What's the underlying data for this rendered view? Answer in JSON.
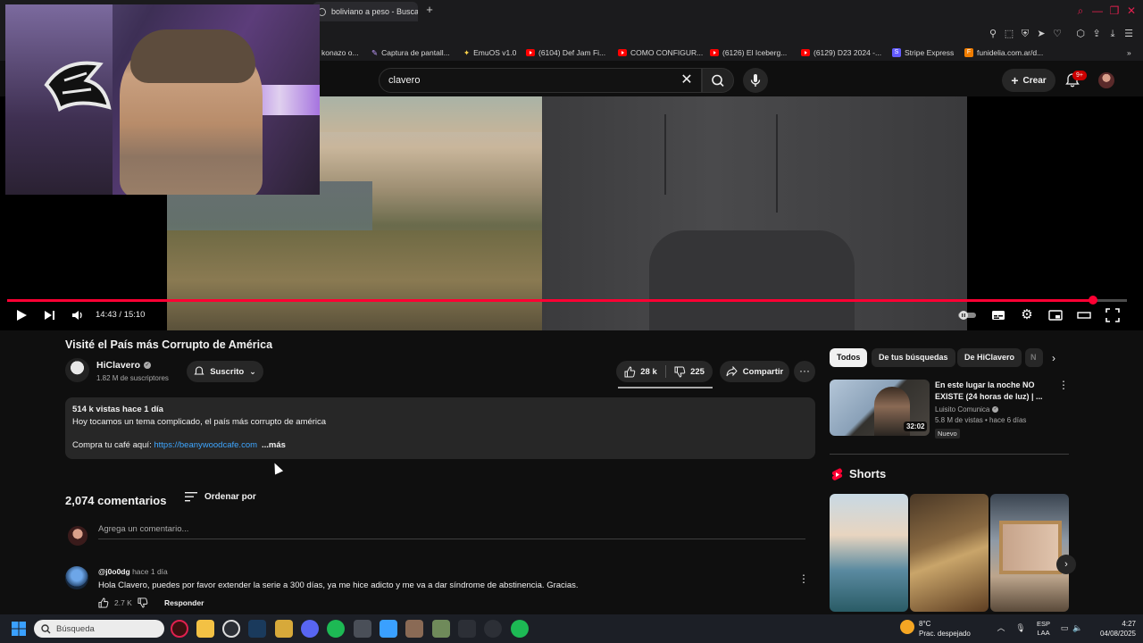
{
  "browser": {
    "tab_title": "boliviano a peso - Buscar",
    "bookmarks": [
      {
        "label": "konazo o..."
      },
      {
        "label": "Captura de pantall..."
      },
      {
        "label": "EmuOS v1.0"
      },
      {
        "label": "(6104) Def Jam Fi..."
      },
      {
        "label": "COMO CONFIGUR..."
      },
      {
        "label": "(6126) El Iceberg..."
      },
      {
        "label": "(6129) D23 2024 -..."
      },
      {
        "label": "Stripe Express"
      },
      {
        "label": "funidelia.com.ar/d..."
      }
    ]
  },
  "header": {
    "search_value": "clavero",
    "create_label": "Crear",
    "notifications_badge": "9+"
  },
  "player": {
    "time": "14:43 / 15:10",
    "progress": 0.97
  },
  "video": {
    "title": "Visité el País más Corrupto de América",
    "channel_name": "HiClavero",
    "subscribers": "1.82 M de suscriptores",
    "subscribe_label": "Suscrito",
    "likes": "28 k",
    "dislikes": "225",
    "share_label": "Compartir",
    "views_date": "514 k vistas  hace 1 día",
    "description_line1": "Hoy tocamos un tema complicado, el país más corrupto de américa",
    "description_prefix": "Compra tu café aquí: ",
    "description_link": "https://beanywoodcafe.com",
    "more_label": "...más"
  },
  "comments": {
    "count": "2,074 comentarios",
    "sort_label": "Ordenar por",
    "add_placeholder": "Agrega un comentario...",
    "items": [
      {
        "author": "@j0o0dg",
        "time": "hace 1 día",
        "text": "Hola Clavero, puedes por favor extender la serie a 300 días, ya me hice adicto y me va a dar síndrome de abstinencia. Gracias.",
        "likes": "2.7 K",
        "reply_label": "Responder"
      }
    ]
  },
  "sidebar": {
    "chips": [
      "Todos",
      "De tus búsquedas",
      "De HiClavero",
      "N"
    ],
    "recommended": {
      "title": "En este lugar la noche NO EXISTE (24 horas de luz) | ...",
      "channel": "Luisito Comunica",
      "meta": "5.8 M de vistas • hace 6 días",
      "badge": "Nuevo",
      "duration": "32:02"
    },
    "shorts_title": "Shorts"
  },
  "taskbar": {
    "search_placeholder": "Búsqueda",
    "weather_temp": "8°C",
    "weather_desc": "Prac. despejado",
    "lang_line1": "ESP",
    "lang_line2": "LAA",
    "time": "4:27",
    "date": "04/08/2025"
  },
  "colors": {
    "accent": "#ff0033",
    "background": "#0f0f0f",
    "link": "#3ea6ff"
  }
}
